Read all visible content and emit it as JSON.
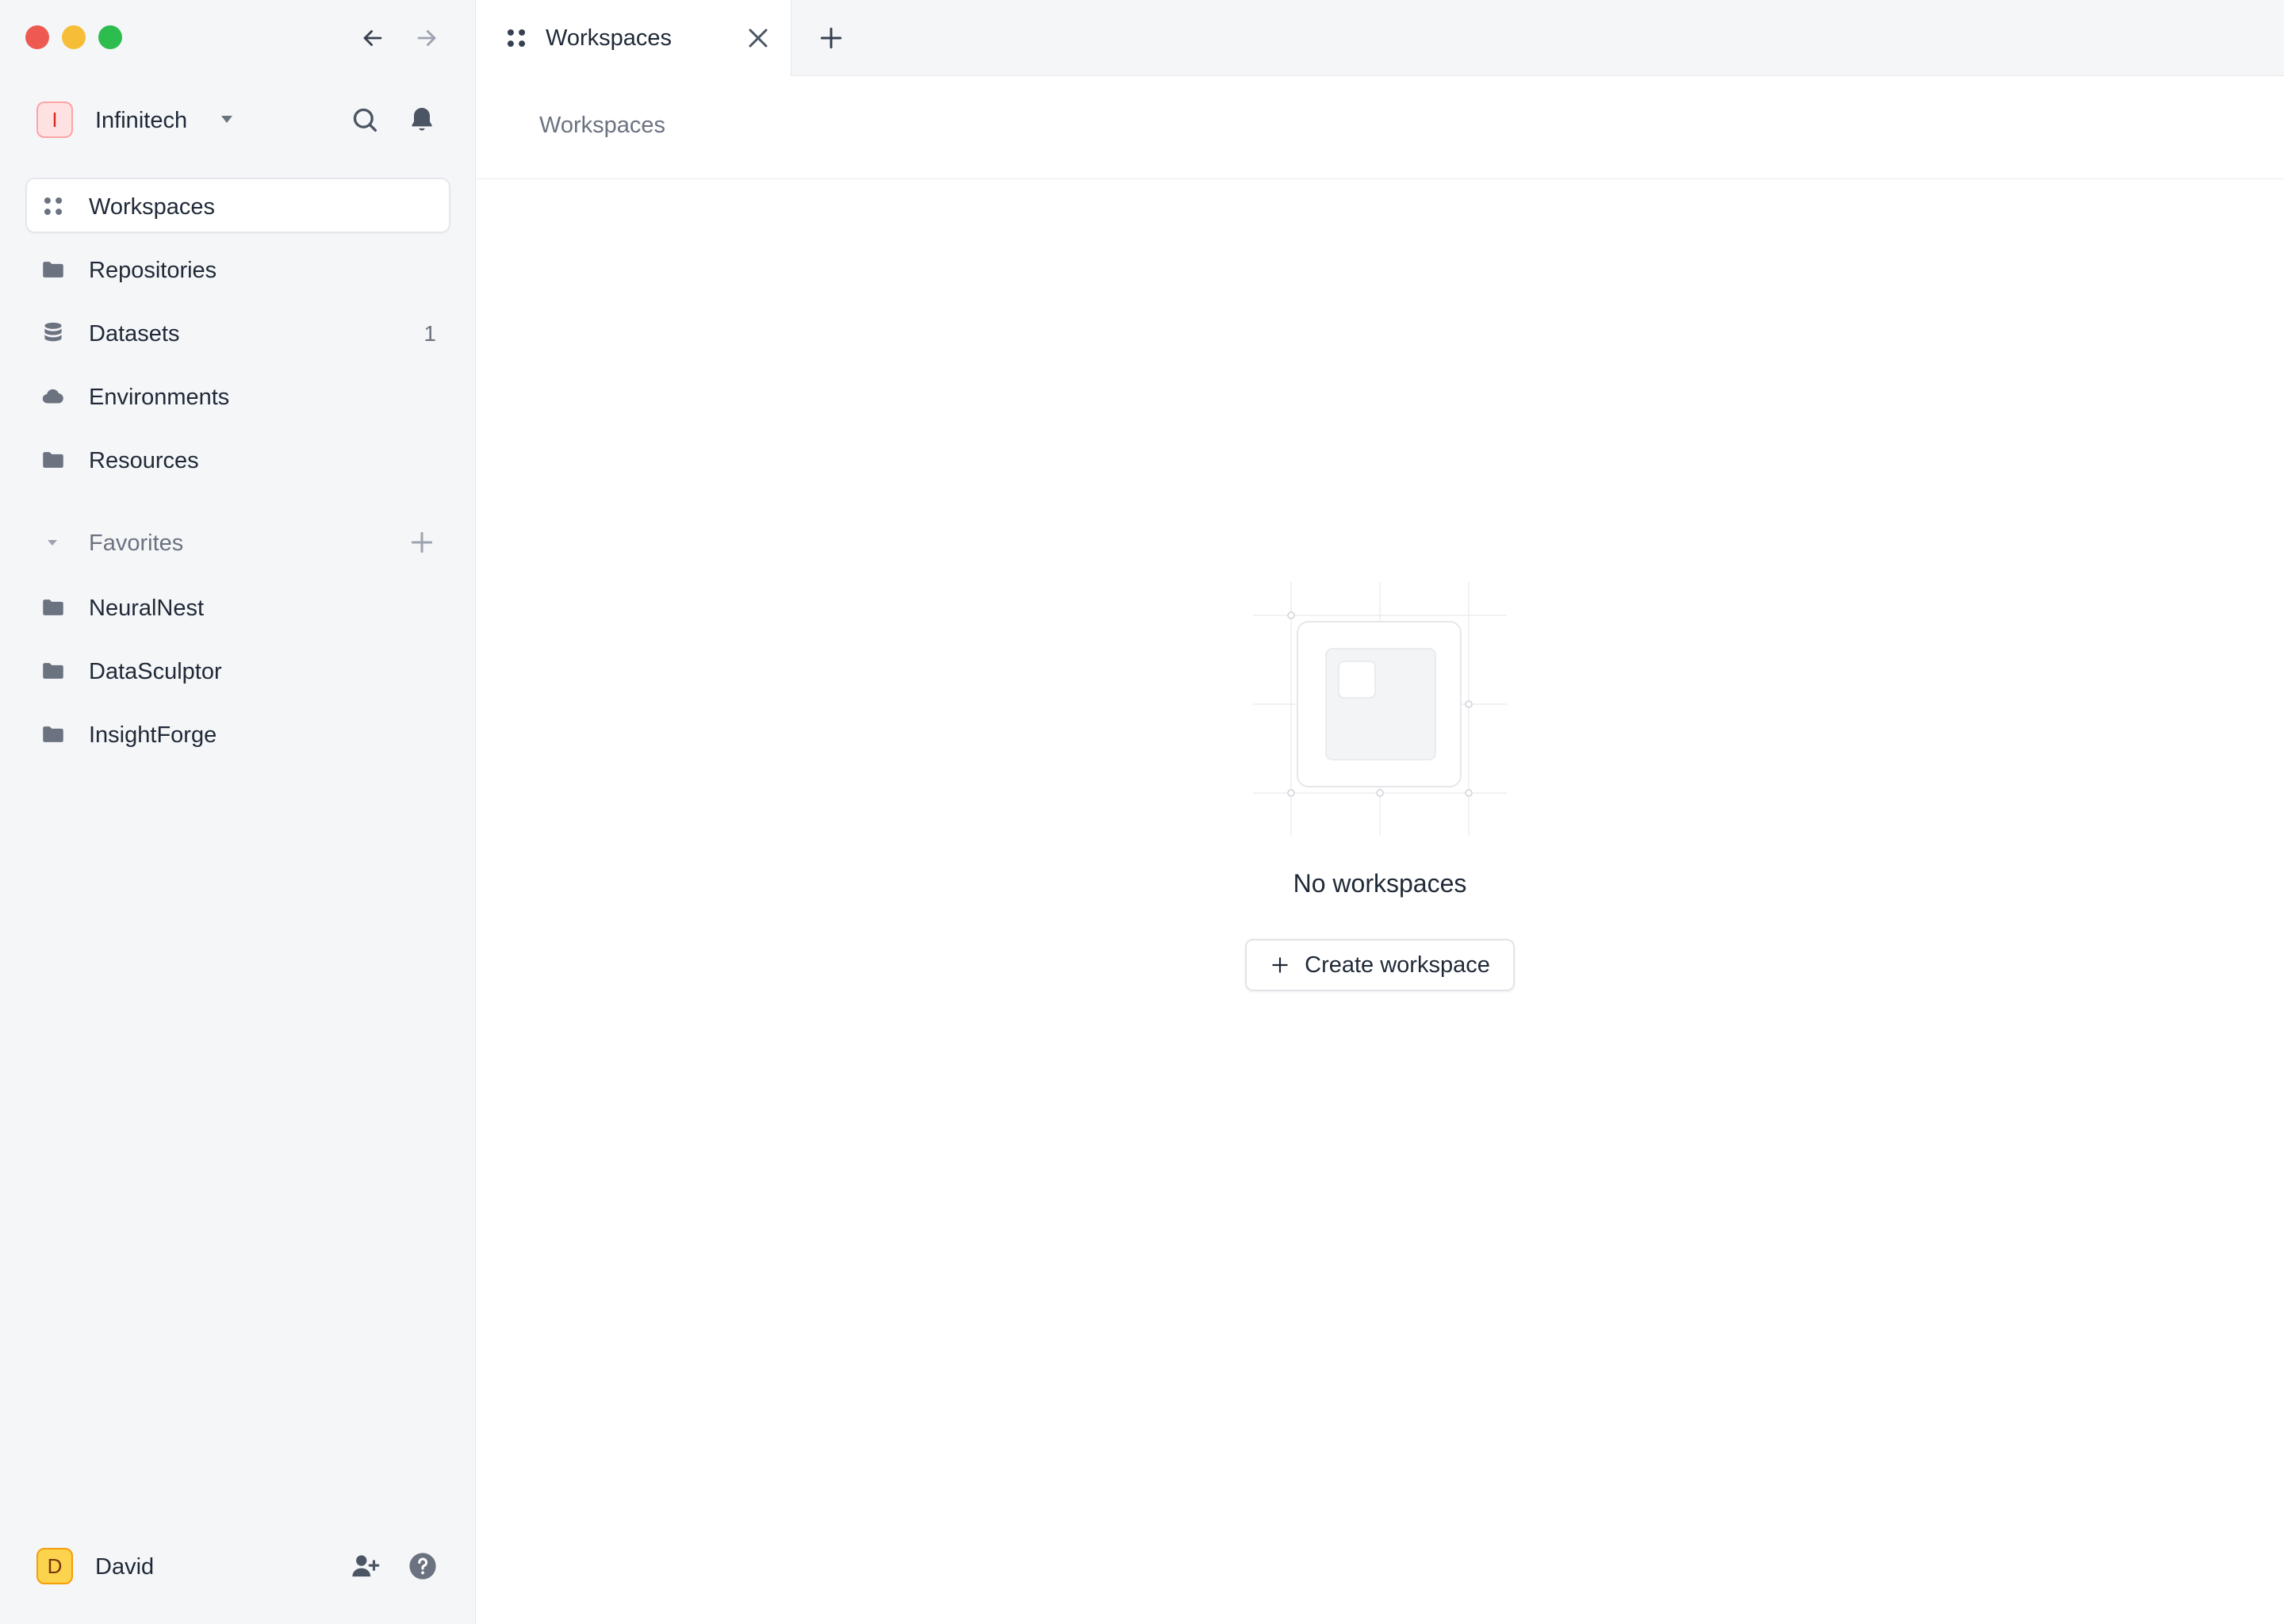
{
  "sidebar": {
    "org": {
      "initial": "I",
      "name": "Infinitech"
    },
    "nav": [
      {
        "label": "Workspaces",
        "icon": "grid-dots-icon",
        "count": "",
        "active": true
      },
      {
        "label": "Repositories",
        "icon": "folder-icon",
        "count": ""
      },
      {
        "label": "Datasets",
        "icon": "database-icon",
        "count": "1"
      },
      {
        "label": "Environments",
        "icon": "cloud-icon",
        "count": ""
      },
      {
        "label": "Resources",
        "icon": "folder-icon",
        "count": ""
      }
    ],
    "favorites": {
      "title": "Favorites",
      "items": [
        {
          "label": "NeuralNest",
          "icon": "folder-icon"
        },
        {
          "label": "DataSculptor",
          "icon": "folder-icon"
        },
        {
          "label": "InsightForge",
          "icon": "folder-icon"
        }
      ]
    },
    "user": {
      "initial": "D",
      "name": "David"
    }
  },
  "tabs": [
    {
      "label": "Workspaces",
      "icon": "grid-dots-icon"
    }
  ],
  "breadcrumb": "Workspaces",
  "empty_state": {
    "title": "No workspaces",
    "button_label": "Create workspace"
  },
  "colors": {
    "close": "#ee5a52",
    "minimize": "#f6be36",
    "zoom": "#2dbd4e",
    "org_badge": "#fee2e2",
    "user_badge": "#fcd34d",
    "icon_gray": "#6b7280"
  }
}
